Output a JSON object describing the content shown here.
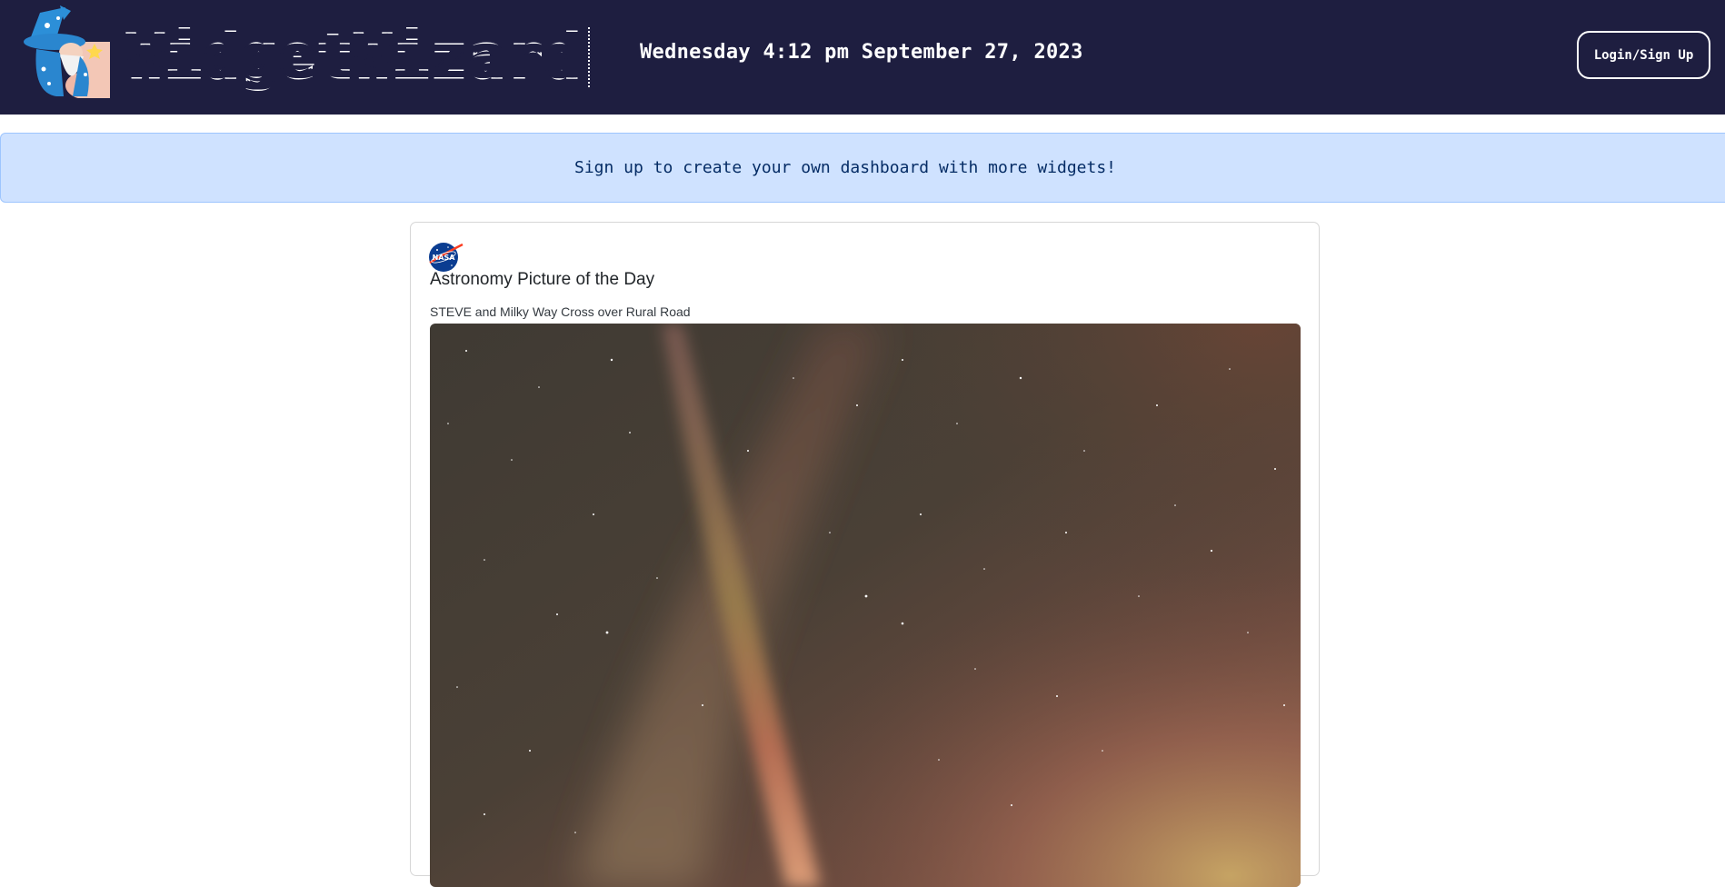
{
  "header": {
    "logo_text": "WidgetWizard",
    "logo_icon": "wizard-mascot-icon",
    "datetime": "Wednesday 4:12 pm September 27, 2023",
    "login_label": "Login/Sign Up"
  },
  "alert": {
    "message": "Sign up to create your own dashboard with more widgets!"
  },
  "apod_card": {
    "icon": "nasa-logo-icon",
    "title": "Astronomy Picture of the Day",
    "subtitle": "STEVE and Milky Way Cross over Rural Road"
  },
  "colors": {
    "navbar_bg": "#1e1e40",
    "alert_bg": "#cfe2ff",
    "alert_border": "#9ec5fe",
    "alert_text": "#052c65"
  }
}
